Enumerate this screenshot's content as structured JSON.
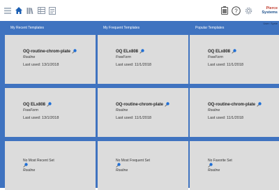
{
  "toolbar": {
    "left_icons": [
      "menu-icon",
      "home-icon",
      "library-icon",
      "table-icon",
      "document-icon"
    ],
    "right_icons": [
      "battery-icon",
      "help-icon",
      "settings-icon"
    ],
    "brand_line1": "Pierce",
    "brand_line2": "Systems"
  },
  "content": {
    "user_line": "User: Syste",
    "columns": [
      {
        "title": "My Recent Templates",
        "cards": [
          {
            "name": "OQ-routine-chrom-plate",
            "type": "Routine",
            "last_used": "Last used: 13/1/2018"
          },
          {
            "name": "OQ ELx808",
            "type": "FreeForm",
            "last_used": "Last used: 13/1/2018"
          },
          {
            "empty": true,
            "name": "No Most Recent Set",
            "type": "Routine"
          }
        ]
      },
      {
        "title": "My Frequent Templates",
        "cards": [
          {
            "name": "OQ ELx808",
            "type": "FreeForm",
            "last_used": "Last used: 11/1/2018"
          },
          {
            "name": "OQ-routine-chrom-plate",
            "type": "Routine",
            "last_used": "Last used: 11/1/2018"
          },
          {
            "empty": true,
            "name": "No Most Frequent Set",
            "type": "Routine"
          }
        ]
      },
      {
        "title": "Popular Templates",
        "cards": [
          {
            "name": "OQ ELx808",
            "type": "FreeForm",
            "last_used": "Last used: 11/1/2018"
          },
          {
            "name": "OQ-routine-chrom-plate",
            "type": "Routine",
            "last_used": "Last used: 11/1/2018"
          },
          {
            "empty": true,
            "name": "No Favorite Set",
            "type": "Routine"
          }
        ]
      }
    ]
  },
  "colors": {
    "panel_blue": "#3f73c0",
    "card_gray": "#dcdcdc",
    "pin_blue": "#1f6fd6"
  }
}
